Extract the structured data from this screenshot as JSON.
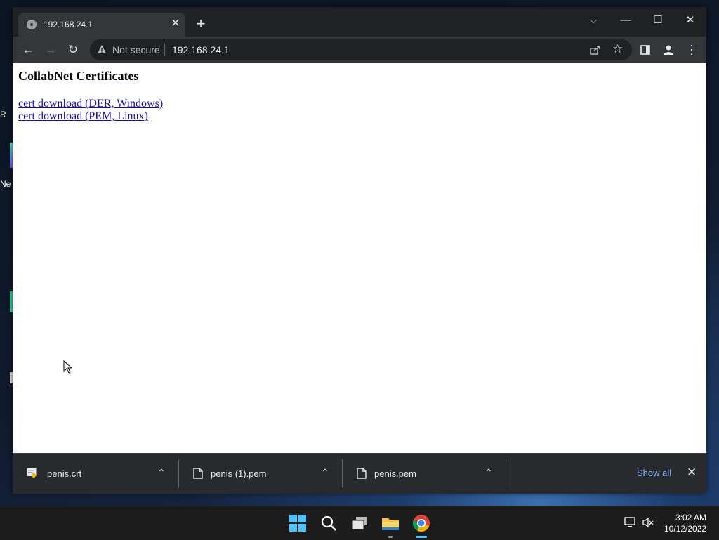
{
  "browser": {
    "tab_title": "192.168.24.1",
    "not_secure_label": "Not secure",
    "url": "192.168.24.1"
  },
  "page": {
    "heading": "CollabNet Certificates",
    "links": [
      "cert download (DER, Windows)",
      "cert download (PEM, Linux)"
    ]
  },
  "downloads": {
    "items": [
      {
        "name": "penis.crt",
        "icon": "certificate-file-icon"
      },
      {
        "name": "penis (1).pem",
        "icon": "file-icon"
      },
      {
        "name": "penis.pem",
        "icon": "file-icon"
      }
    ],
    "show_all_label": "Show all"
  },
  "desktop": {
    "fragments": [
      "R",
      "Ne"
    ]
  },
  "taskbar": {
    "apps": [
      "start-icon",
      "search-icon",
      "task-view-icon",
      "file-explorer-icon",
      "chrome-icon"
    ],
    "time": "3:02 AM",
    "date": "10/12/2022"
  },
  "colors": {
    "chrome_dark": "#202124",
    "chrome_toolbar": "#35363a",
    "link": "#1a0dab",
    "accent": "#8ab4f8"
  }
}
